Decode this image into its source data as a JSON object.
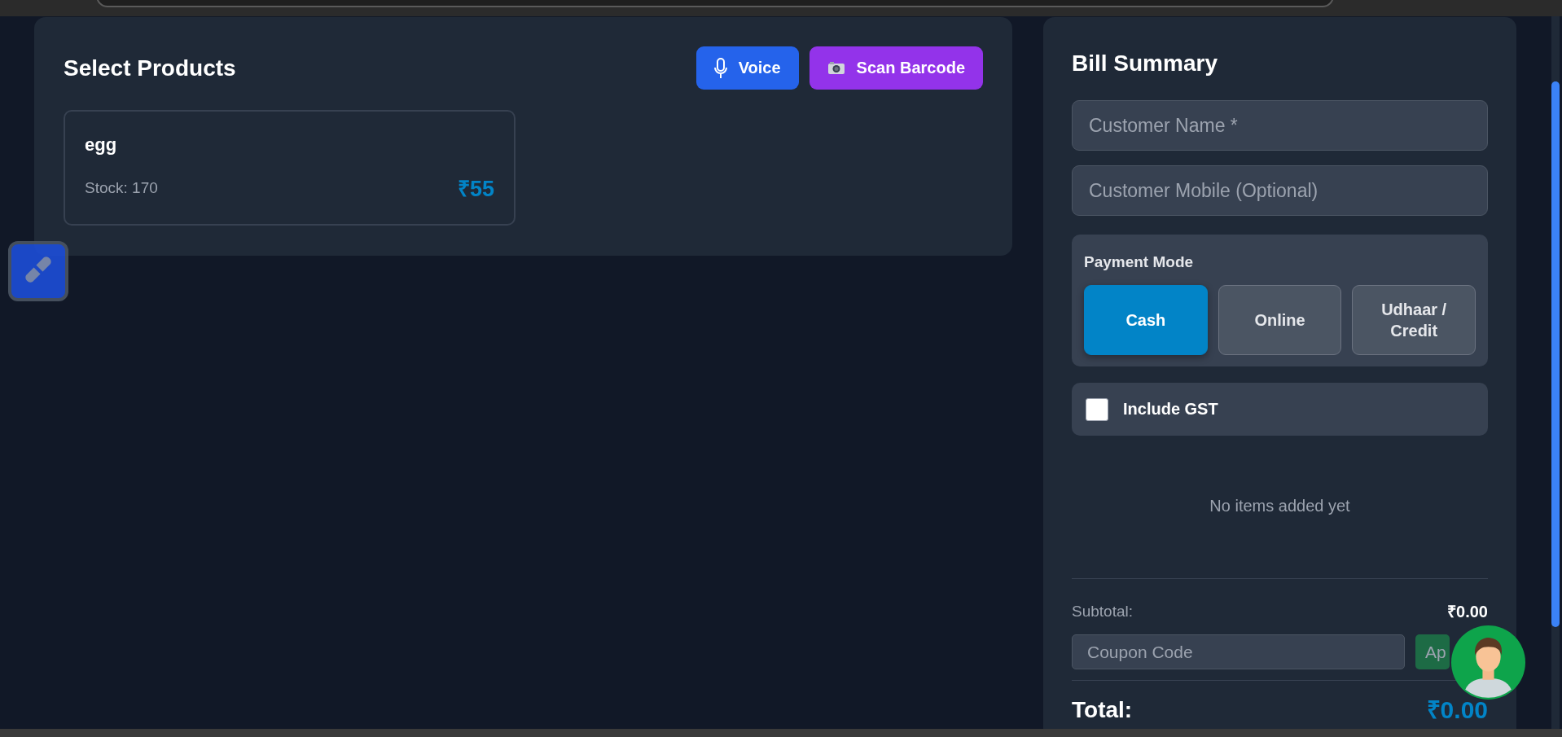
{
  "products_panel": {
    "title": "Select Products",
    "actions": [
      {
        "kind": "voice",
        "label": "Voice"
      },
      {
        "kind": "barcode",
        "label": "Scan Barcode"
      }
    ],
    "products": [
      {
        "name": "egg",
        "stock": "Stock: 170",
        "price": "₹55"
      }
    ]
  },
  "bill_summary": {
    "title": "Bill Summary",
    "customer_name": {
      "placeholder": "Customer Name *"
    },
    "customer_mobile": {
      "placeholder": "Customer Mobile (Optional)"
    },
    "payment_mode": {
      "label": "Payment Mode",
      "options": [
        {
          "label": "Cash",
          "selected": true
        },
        {
          "label": "Online",
          "selected": false
        },
        {
          "label": "Udhaar / Credit",
          "selected": false
        }
      ]
    },
    "gst": {
      "label": "Include GST",
      "checked": false
    },
    "empty_message": "No items added yet",
    "subtotal": {
      "label": "Subtotal:",
      "value": "₹0.00"
    },
    "coupon": {
      "placeholder": "Coupon Code",
      "button": "Ap"
    },
    "total": {
      "label": "Total:",
      "value": "₹0.00"
    }
  }
}
